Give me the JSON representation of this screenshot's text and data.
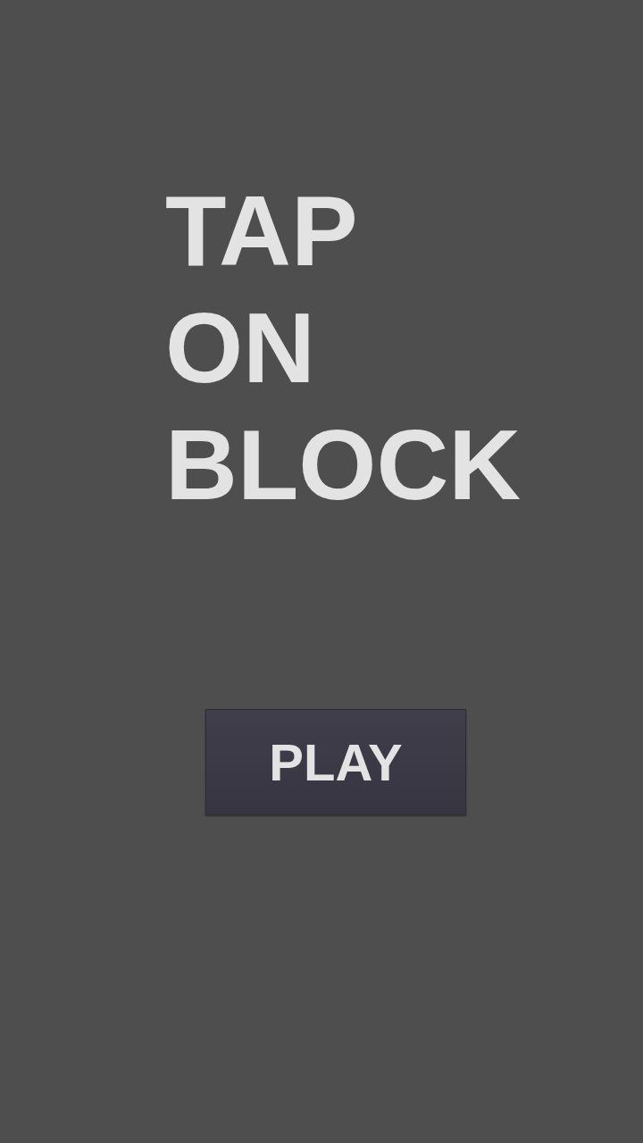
{
  "title_lines": [
    "TAP",
    "ON",
    "BLOCK"
  ],
  "play_button": {
    "label": "PLAY"
  }
}
